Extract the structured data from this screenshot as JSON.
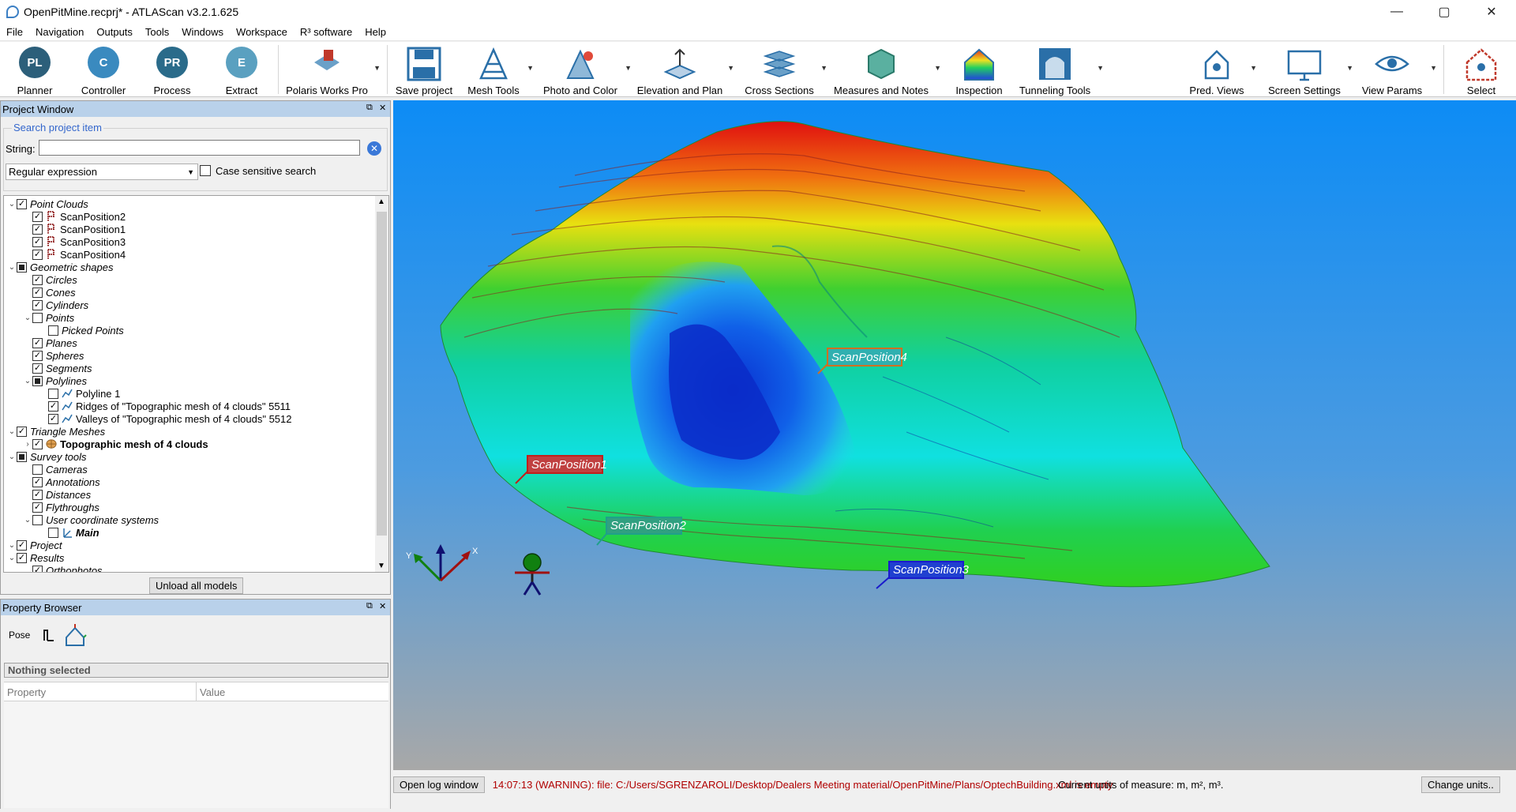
{
  "window": {
    "title": "OpenPitMine.recprj* - ATLAScan v3.2.1.625",
    "controls": {
      "minimize": "—",
      "maximize": "▢",
      "close": "✕"
    }
  },
  "menu": [
    "File",
    "Navigation",
    "Outputs",
    "Tools",
    "Windows",
    "Workspace",
    "R³ software",
    "Help"
  ],
  "toolbar": {
    "planner": "Planner",
    "controller": "Controller",
    "process": "Process",
    "extract": "Extract",
    "polaris": "Polaris Works Pro",
    "save": "Save project",
    "mesh": "Mesh Tools",
    "photo": "Photo and Color",
    "elevation": "Elevation and Plan",
    "cross": "Cross Sections",
    "measures": "Measures and Notes",
    "inspection": "Inspection",
    "tunneling": "Tunneling Tools",
    "pred": "Pred. Views",
    "screen": "Screen Settings",
    "view": "View Params",
    "select": "Select",
    "badge_pl": "PL",
    "badge_c": "C",
    "badge_pr": "PR",
    "badge_e": "E"
  },
  "project_window": {
    "title": "Project Window",
    "search_group": "Search project item",
    "string_label": "String:",
    "string_value": "",
    "mode": "Regular expression",
    "case_sensitive": "Case sensitive search",
    "unload_button": "Unload all models",
    "tree": [
      {
        "label": "Point Clouds",
        "level": 0,
        "expand": "open",
        "check": "checked",
        "italic": true
      },
      {
        "label": "ScanPosition2",
        "level": 1,
        "check": "checked",
        "icon": "cloud"
      },
      {
        "label": "ScanPosition1",
        "level": 1,
        "check": "checked",
        "icon": "cloud"
      },
      {
        "label": "ScanPosition3",
        "level": 1,
        "check": "checked",
        "icon": "cloud"
      },
      {
        "label": "ScanPosition4",
        "level": 1,
        "check": "checked",
        "icon": "cloud"
      },
      {
        "label": "Geometric shapes",
        "level": 0,
        "expand": "open",
        "check": "partial",
        "italic": true
      },
      {
        "label": "Circles",
        "level": 1,
        "check": "checked",
        "italic": true
      },
      {
        "label": "Cones",
        "level": 1,
        "check": "checked",
        "italic": true
      },
      {
        "label": "Cylinders",
        "level": 1,
        "check": "checked",
        "italic": true
      },
      {
        "label": "Points",
        "level": 1,
        "expand": "open",
        "check": "unchecked",
        "italic": true
      },
      {
        "label": "Picked Points",
        "level": 2,
        "check": "unchecked",
        "italic": true
      },
      {
        "label": "Planes",
        "level": 1,
        "check": "checked",
        "italic": true
      },
      {
        "label": "Spheres",
        "level": 1,
        "check": "checked",
        "italic": true
      },
      {
        "label": "Segments",
        "level": 1,
        "check": "checked",
        "italic": true
      },
      {
        "label": "Polylines",
        "level": 1,
        "expand": "open",
        "check": "partial",
        "italic": true
      },
      {
        "label": "Polyline 1",
        "level": 2,
        "check": "unchecked",
        "icon": "polyline"
      },
      {
        "label": "Ridges of \"Topographic mesh of 4 clouds\" 5511",
        "level": 2,
        "check": "checked",
        "icon": "polyline"
      },
      {
        "label": "Valleys of \"Topographic mesh of 4 clouds\" 5512",
        "level": 2,
        "check": "checked",
        "icon": "polyline"
      },
      {
        "label": "Triangle Meshes",
        "level": 0,
        "expand": "open",
        "check": "checked",
        "italic": true
      },
      {
        "label": "Topographic mesh of 4 clouds",
        "level": 1,
        "expand": "closed",
        "check": "checked",
        "icon": "mesh",
        "bold": true
      },
      {
        "label": "Survey tools",
        "level": 0,
        "expand": "open",
        "check": "partial",
        "italic": true
      },
      {
        "label": "Cameras",
        "level": 1,
        "check": "unchecked",
        "italic": true
      },
      {
        "label": "Annotations",
        "level": 1,
        "check": "checked",
        "italic": true
      },
      {
        "label": "Distances",
        "level": 1,
        "check": "checked",
        "italic": true
      },
      {
        "label": "Flythroughs",
        "level": 1,
        "check": "checked",
        "italic": true
      },
      {
        "label": "User coordinate systems",
        "level": 1,
        "expand": "open",
        "check": "unchecked",
        "italic": true
      },
      {
        "label": "Main",
        "level": 2,
        "check": "unchecked",
        "icon": "ucs",
        "bold": true,
        "italic": true
      },
      {
        "label": "Project",
        "level": 0,
        "expand": "open",
        "check": "checked",
        "italic": true
      },
      {
        "label": "Results",
        "level": 0,
        "expand": "open",
        "check": "checked",
        "italic": true
      },
      {
        "label": "Orthophotos",
        "level": 1,
        "check": "checked",
        "italic": true
      }
    ]
  },
  "property_browser": {
    "title": "Property Browser",
    "pose_label": "Pose",
    "selection": "Nothing selected",
    "col_property": "Property",
    "col_value": "Value"
  },
  "viewport": {
    "labels": {
      "sp1": "ScanPosition1",
      "sp2": "ScanPosition2",
      "sp3": "ScanPosition3",
      "sp4": "ScanPosition4"
    },
    "axes": {
      "x": "X",
      "y": "Y"
    },
    "colors": {
      "sp1": "#c0201c",
      "sp2": "#1fa08a",
      "sp3": "#1a1acc",
      "sp4": "#d07020",
      "bg_top": "#0d8cf5",
      "bg_bottom": "#a8a8a8"
    }
  },
  "status": {
    "log_button": "Open log window",
    "message": "14:07:13 (WARNING): file: C:/Users/SGRENZAROLI/Desktop/Dealers Meeting material/OpenPitMine/Plans/OptechBuilding.xml is empty",
    "units": "Current units of measure: m, m², m³.",
    "change_units": "Change units.."
  }
}
